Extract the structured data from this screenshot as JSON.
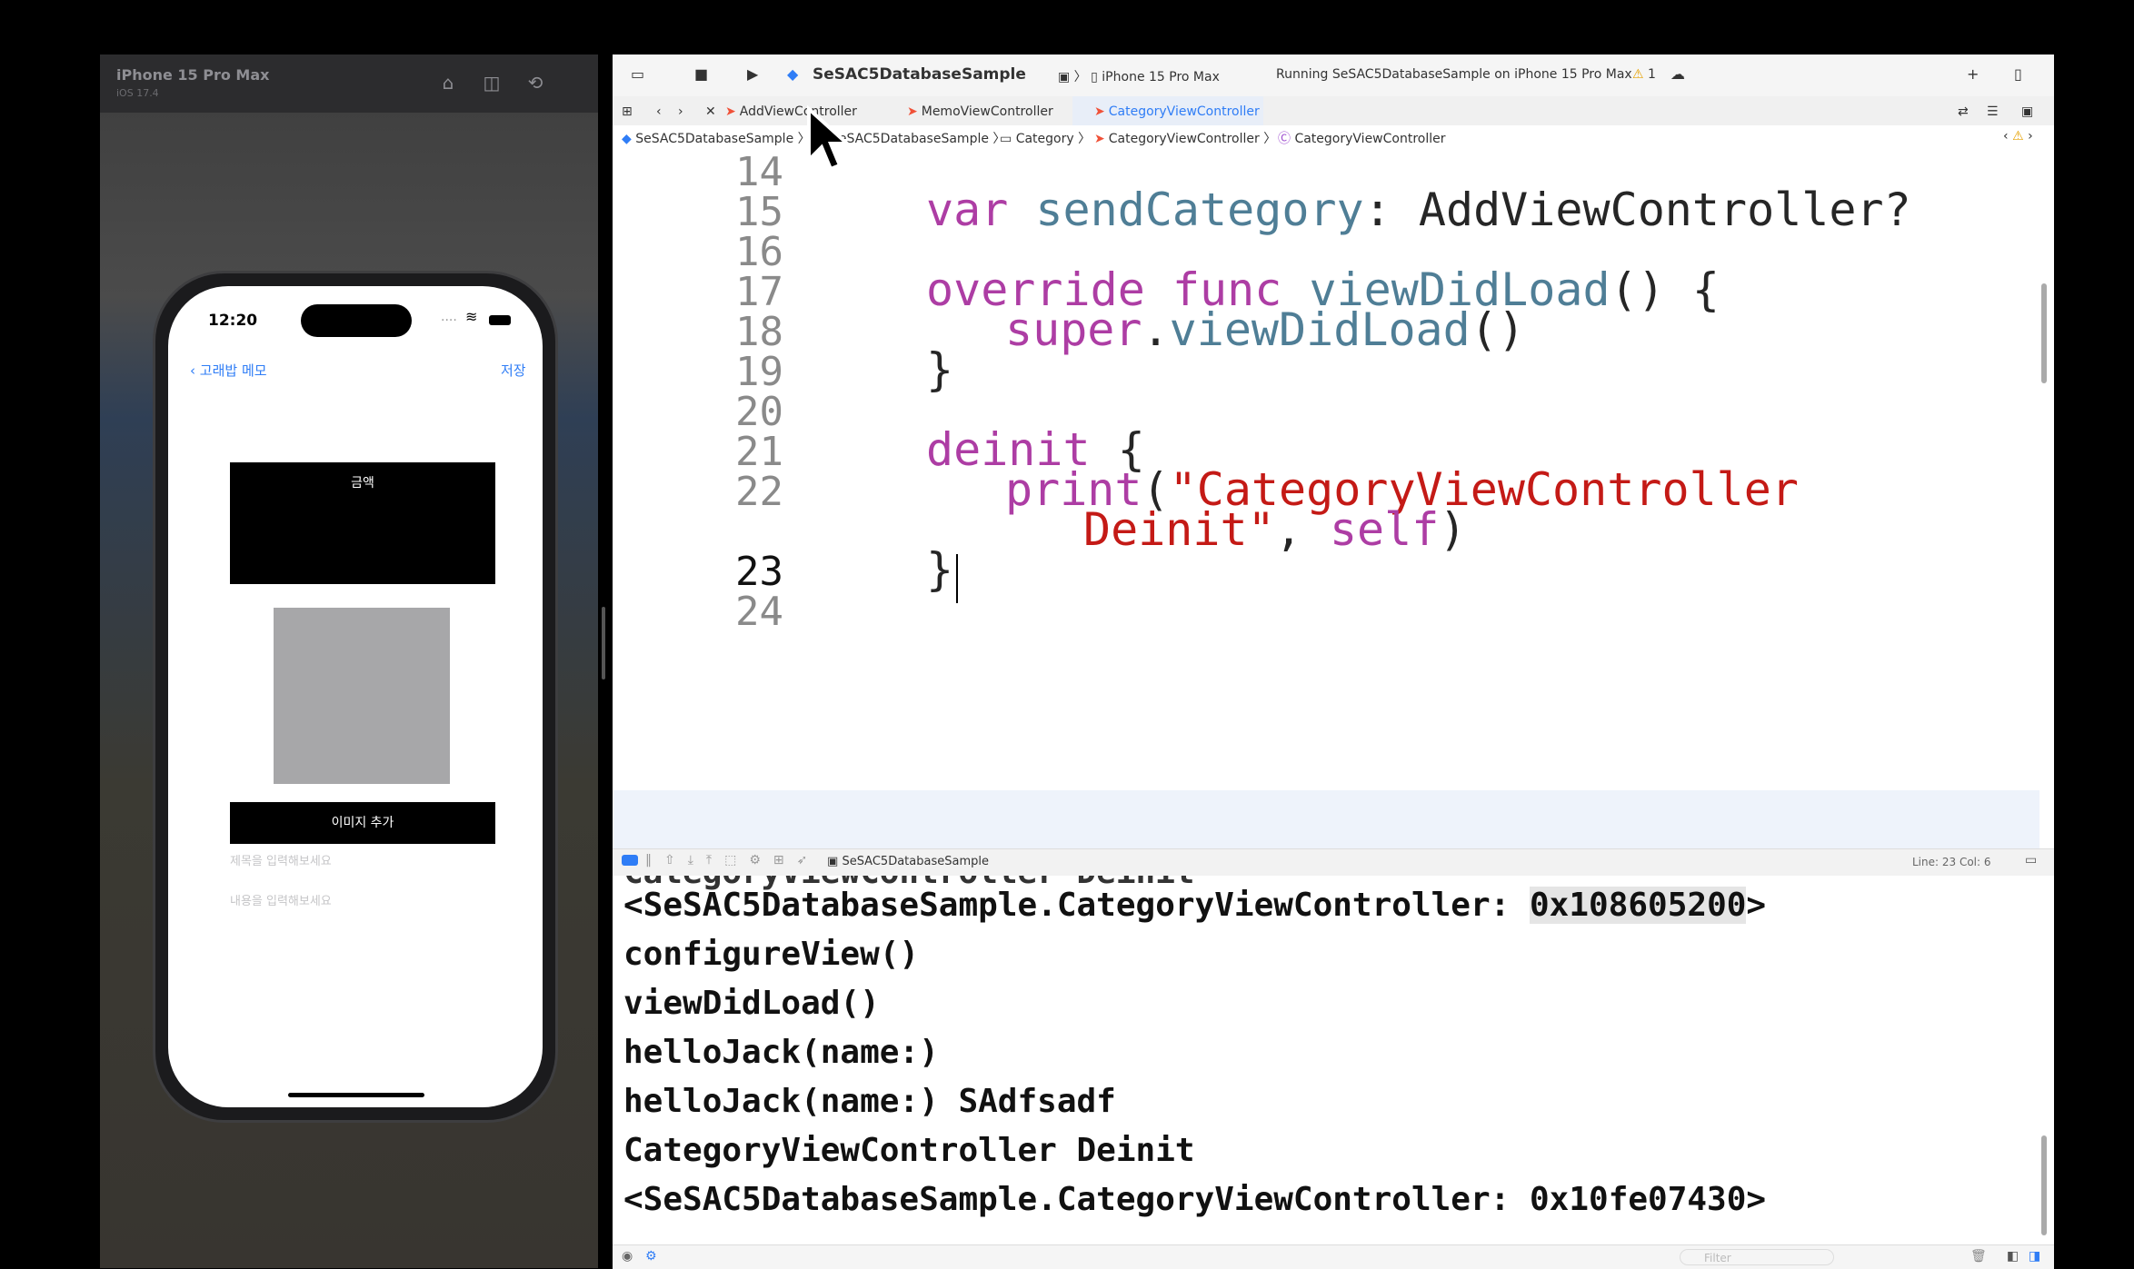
{
  "simulator": {
    "device": "iPhone 15 Pro Max",
    "os": "iOS 17.4",
    "phone": {
      "time": "12:20",
      "status_dots": "....",
      "nav_back": "고래밥 메모",
      "nav_save": "저장",
      "btn_amount": "금액",
      "btn_add_image": "이미지 추가",
      "title_placeholder": "제목을 입력해보세요",
      "content_placeholder": "내용을 입력해보세요"
    }
  },
  "xcode": {
    "scheme": "SeSAC5DatabaseSample",
    "destination": "iPhone 15 Pro Max",
    "status": "Running SeSAC5DatabaseSample on iPhone 15 Pro Max",
    "warnings": "1",
    "tabs": [
      "AddViewController",
      "MemoViewController",
      "CategoryViewController"
    ],
    "breadcrumb": [
      "SeSAC5DatabaseSample",
      "SeSAC5DatabaseSample",
      "Category",
      "CategoryViewController",
      "CategoryViewController"
    ],
    "line_numbers": [
      "14",
      "15",
      "16",
      "17",
      "18",
      "19",
      "20",
      "21",
      "22",
      "23",
      "24"
    ],
    "code": {
      "l15_kw": "var",
      "l15_name": "sendCategory",
      "l15_colon": ": ",
      "l15_type": "AddViewController",
      "l15_q": "?",
      "l17_kw1": "override",
      "l17_kw2": "func",
      "l17_fn": "viewDidLoad",
      "l17_rest": "() {",
      "l18_kw": "super",
      "l18_dot": ".",
      "l18_fn": "viewDidLoad",
      "l18_rest": "()",
      "l19": "}",
      "l21_kw": "deinit",
      "l21_rest": " {",
      "l22_fn": "print",
      "l22_paren": "(",
      "l22_str": "\"CategoryViewController",
      "l22b_str": "Deinit\"",
      "l22b_comma": ", ",
      "l22b_self": "self",
      "l22b_close": ")",
      "l23": "}"
    },
    "debug_target": "SeSAC5DatabaseSample",
    "cursor_pos": "Line: 23  Col: 6",
    "console": {
      "partial": "CategoryViewController Deinit",
      "l1_prefix": "<SeSAC5DatabaseSample.CategoryViewController: ",
      "l1_addr": "0x108605200",
      "l1_suffix": ">",
      "l2": "configureView()",
      "l3": "viewDidLoad()",
      "l4": "helloJack(name:)",
      "l5": "helloJack(name:) SAdfsadf",
      "l6": "CategoryViewController Deinit",
      "l7": "<SeSAC5DatabaseSample.CategoryViewController: 0x10fe07430>"
    },
    "filter_placeholder": "Filter"
  }
}
